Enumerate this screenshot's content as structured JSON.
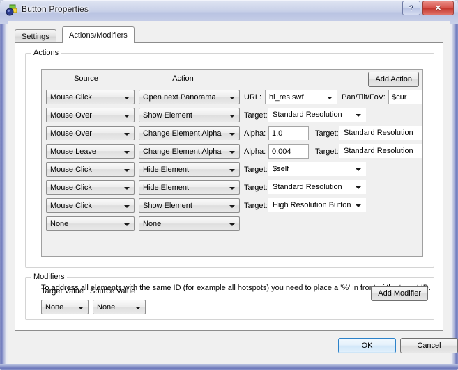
{
  "window": {
    "title": "Button Properties",
    "icon": "app-icon",
    "help_label": "?",
    "close_label": "✕",
    "accent_blue": "#6d79bb",
    "close_red": "#c2342b"
  },
  "tabs": [
    {
      "id": "settings",
      "label": "Settings",
      "active": false
    },
    {
      "id": "actions-modifiers",
      "label": "Actions/Modifiers",
      "active": true
    }
  ],
  "actions_group": {
    "legend": "Actions",
    "columns": {
      "source": "Source",
      "action": "Action"
    },
    "add_button": "Add Action",
    "labels": {
      "url": "URL:",
      "pan_tilt_fov": "Pan/Tilt/FoV:",
      "target": "Target:",
      "alpha": "Alpha:"
    },
    "rows": [
      {
        "source": "Mouse Click",
        "action": "Open next Panorama",
        "extra_type": "url",
        "url_label": "URL:",
        "url_value": "hi_res.swf",
        "pantilt_label": "Pan/Tilt/FoV:",
        "pantilt_value": "$cur"
      },
      {
        "source": "Mouse Over",
        "action": "Show Element",
        "extra_type": "target",
        "target_label": "Target:",
        "target_value": "Standard Resolution"
      },
      {
        "source": "Mouse Over",
        "action": "Change Element Alpha",
        "extra_type": "alpha",
        "alpha_label": "Alpha:",
        "alpha_value": "1.0",
        "target_label": "Target:",
        "target_value": "Standard Resolution"
      },
      {
        "source": "Mouse Leave",
        "action": "Change Element Alpha",
        "extra_type": "alpha",
        "alpha_label": "Alpha:",
        "alpha_value": "0.004",
        "target_label": "Target:",
        "target_value": "Standard Resolution"
      },
      {
        "source": "Mouse Click",
        "action": "Hide Element",
        "extra_type": "target",
        "target_label": "Target:",
        "target_value": "$self"
      },
      {
        "source": "Mouse Click",
        "action": "Hide Element",
        "extra_type": "target",
        "target_label": "Target:",
        "target_value": "Standard Resolution"
      },
      {
        "source": "Mouse Click",
        "action": "Show Element",
        "extra_type": "target",
        "target_label": "Target:",
        "target_value": "High Resolution Button"
      },
      {
        "source": "None",
        "action": "None",
        "extra_type": "none"
      }
    ]
  },
  "hint": "To address all elements with the same ID (for example all hotspots) you need to place a '%' in front of the target ID.",
  "modifiers_group": {
    "legend": "Modifiers",
    "target_value_label": "Target Value",
    "source_value_label": "Source Value",
    "target_value": "None",
    "source_value": "None",
    "add_button": "Add Modifier"
  },
  "footer": {
    "ok": "OK",
    "cancel": "Cancel"
  }
}
